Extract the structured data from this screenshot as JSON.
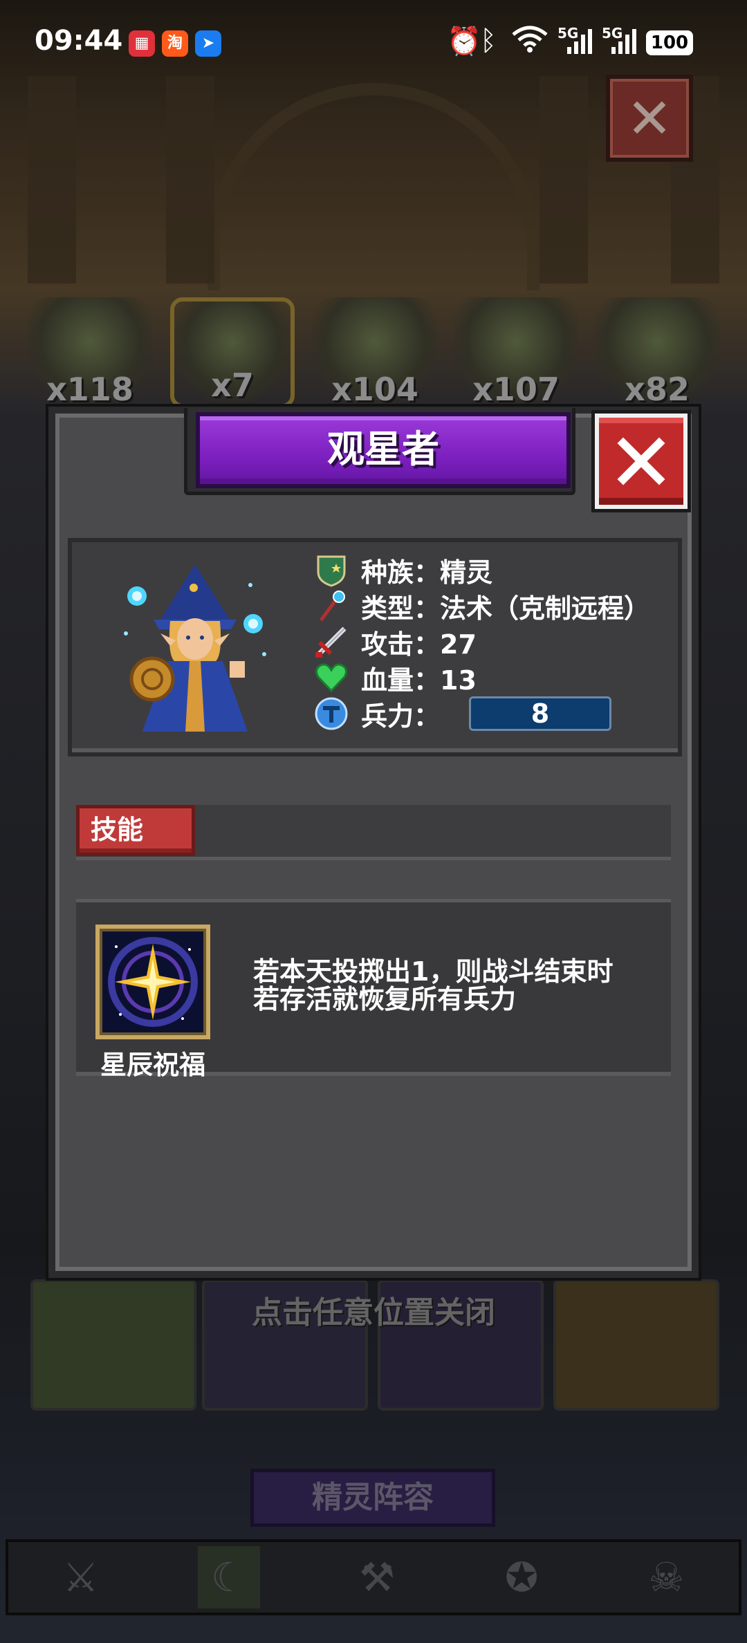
{
  "status_bar": {
    "time": "09:44",
    "apps": [
      "app-icon-a",
      "taobao-icon",
      "share-icon"
    ],
    "indicators": [
      "alarm-icon",
      "bluetooth-icon",
      "wifi-icon",
      "signal-5g-icon",
      "signal-5g-icon"
    ],
    "signal_label_1": "5G",
    "signal_label_2": "5G",
    "battery": "100"
  },
  "background": {
    "hero_counts": [
      "x118",
      "x7",
      "x104",
      "x107",
      "x82"
    ],
    "hint": "点击任意位置关闭",
    "team_button": "精灵阵容",
    "nav_icons": [
      "crossed-swords-icon",
      "elf-crest-icon",
      "crossed-axes-icon",
      "flame-crest-icon",
      "skull-icon"
    ]
  },
  "modal": {
    "title": "观星者",
    "stats": {
      "race": "种族：精灵",
      "type": "类型：法术（克制远程）",
      "attack": "攻击：27",
      "hp": "血量：13",
      "troops_label": "兵力：",
      "troops_value": "8"
    },
    "skill_tab": "技能",
    "skill": {
      "name": "星辰祝福",
      "description_line1": "若本天投掷出1，则战斗结束时",
      "description_line2": "若存活就恢复所有兵力"
    }
  },
  "colors": {
    "title_purple": "#7d20c0",
    "close_red": "#c02a2a",
    "troops_blue": "#0d3c6e",
    "skill_tab_red": "#c03a3a"
  }
}
